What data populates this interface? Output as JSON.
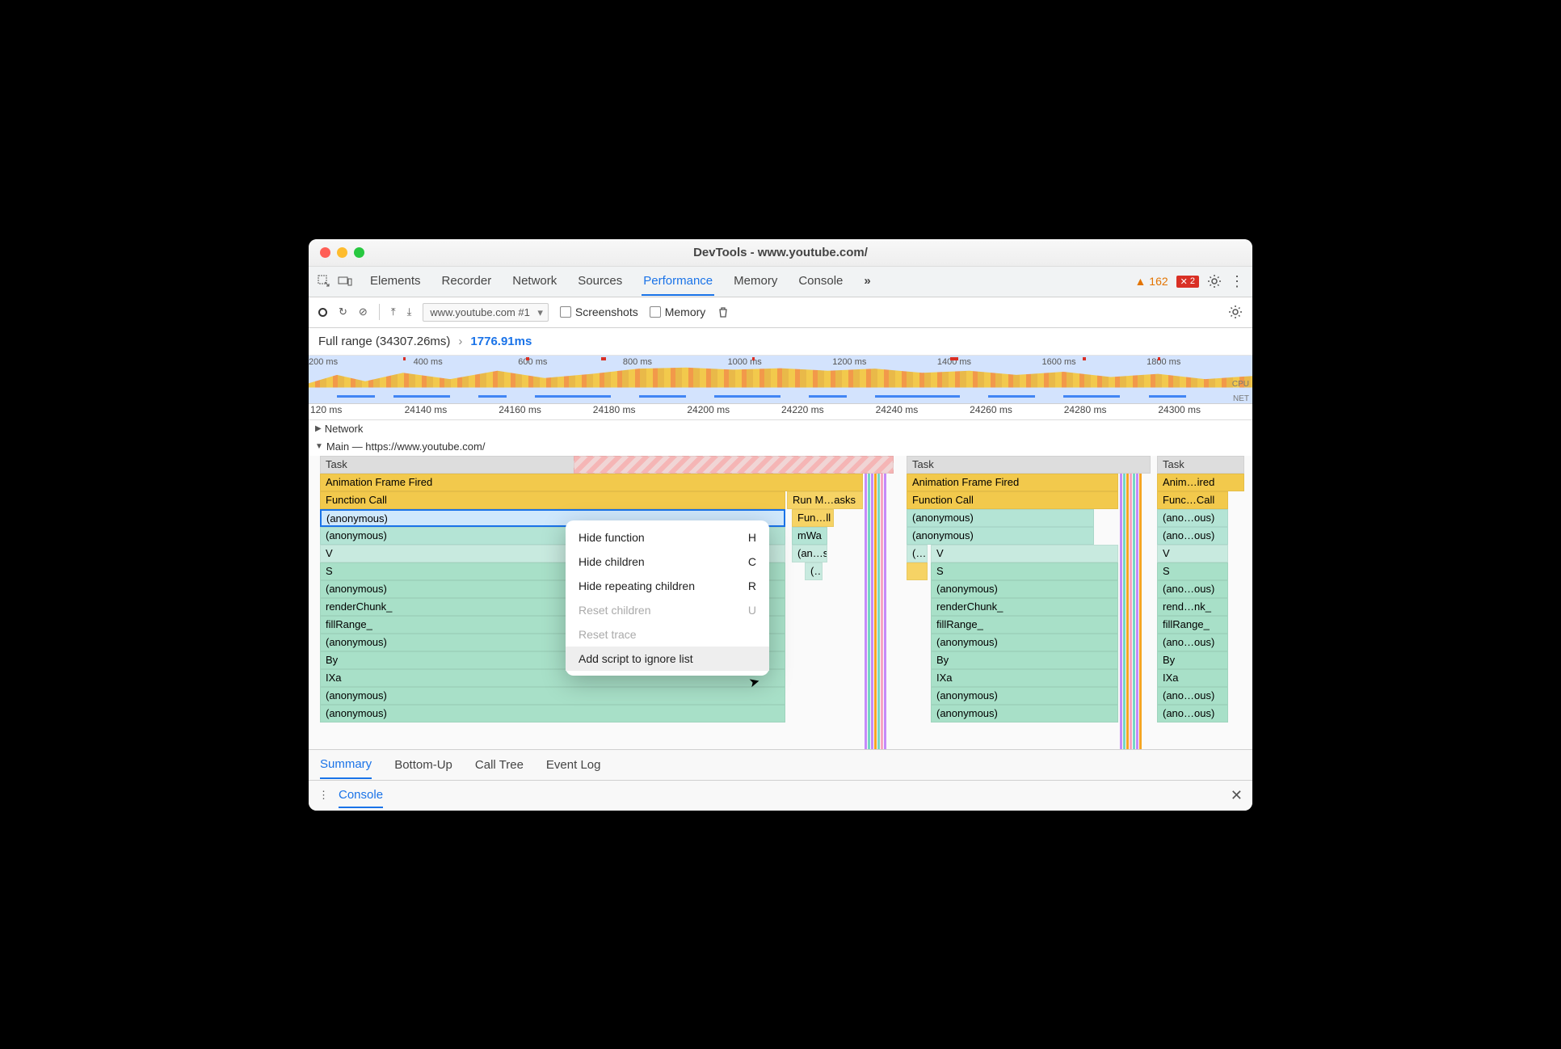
{
  "window": {
    "title": "DevTools - www.youtube.com/"
  },
  "tabs": [
    "Elements",
    "Recorder",
    "Network",
    "Sources",
    "Performance",
    "Memory",
    "Console"
  ],
  "tabs_active_index": 4,
  "tabs_more_glyph": "»",
  "warnings": "162",
  "errors": "2",
  "toolbar": {
    "profile_select": "www.youtube.com #1",
    "chk_screenshots": "Screenshots",
    "chk_memory": "Memory"
  },
  "breadcrumb": {
    "full": "Full range (34307.26ms)",
    "arrow": "›",
    "current": "1776.91ms"
  },
  "overview_ticks": [
    "200 ms",
    "400 ms",
    "600 ms",
    "800 ms",
    "1000 ms",
    "1200 ms",
    "1400 ms",
    "1600 ms",
    "1800 ms"
  ],
  "overview_cpu_label": "CPU",
  "overview_net_label": "NET",
  "ruler_ticks": [
    "120 ms",
    "24140 ms",
    "24160 ms",
    "24180 ms",
    "24200 ms",
    "24220 ms",
    "24240 ms",
    "24260 ms",
    "24280 ms",
    "24300 ms"
  ],
  "tracks": {
    "network": "Network",
    "main": "Main — https://www.youtube.com/"
  },
  "flame_col1": {
    "task": "Task",
    "anim": "Animation Frame Fired",
    "func": "Function Call",
    "anon_sel": "(anonymous)",
    "rows": [
      "(anonymous)",
      "V",
      "S",
      "(anonymous)",
      "renderChunk_",
      "fillRange_",
      "(anonymous)",
      "By",
      "IXa",
      "(anonymous)",
      "(anonymous)"
    ]
  },
  "flame_col1_side": {
    "run": "Run M…asks",
    "fun": "Fun…ll",
    "mwa": "mWa",
    "ans": "(an…s)",
    "paren": "(…"
  },
  "flame_col2": {
    "task": "Task",
    "anim": "Animation Frame Fired",
    "func": "Function Call",
    "rowsA": [
      "(anonymous)",
      "(anonymous)"
    ],
    "cell_paren": "(…",
    "rowsB": [
      "V",
      "S",
      "(anonymous)",
      "renderChunk_",
      "fillRange_",
      "(anonymous)",
      "By",
      "IXa",
      "(anonymous)",
      "(anonymous)"
    ]
  },
  "flame_col3": {
    "task": "Task",
    "anim": "Anim…ired",
    "func": "Func…Call",
    "rows": [
      "(ano…ous)",
      "(ano…ous)",
      "V",
      "S",
      "(ano…ous)",
      "rend…nk_",
      "fillRange_",
      "(ano…ous)",
      "By",
      "IXa",
      "(ano…ous)",
      "(ano…ous)"
    ]
  },
  "context_menu": [
    {
      "label": "Hide function",
      "shortcut": "H",
      "disabled": false,
      "hover": false
    },
    {
      "label": "Hide children",
      "shortcut": "C",
      "disabled": false,
      "hover": false
    },
    {
      "label": "Hide repeating children",
      "shortcut": "R",
      "disabled": false,
      "hover": false
    },
    {
      "label": "Reset children",
      "shortcut": "U",
      "disabled": true,
      "hover": false
    },
    {
      "label": "Reset trace",
      "shortcut": "",
      "disabled": true,
      "hover": false
    },
    {
      "label": "Add script to ignore list",
      "shortcut": "",
      "disabled": false,
      "hover": true
    }
  ],
  "bottom_tabs": [
    "Summary",
    "Bottom-Up",
    "Call Tree",
    "Event Log"
  ],
  "bottom_active": 0,
  "console_label": "Console"
}
